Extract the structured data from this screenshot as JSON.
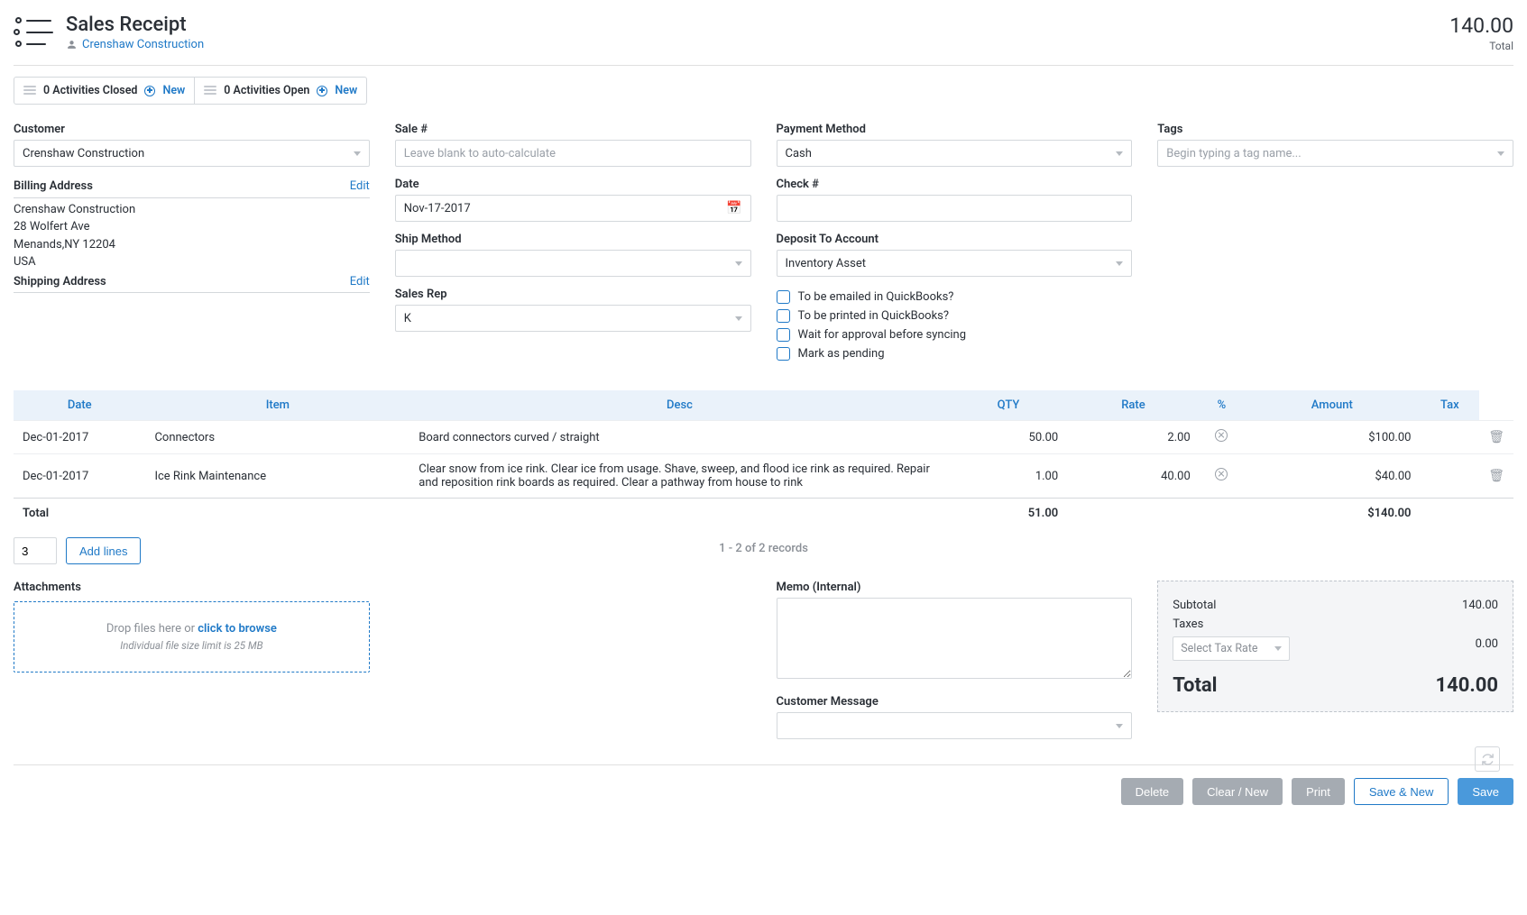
{
  "header": {
    "title": "Sales Receipt",
    "customer_link": "Crenshaw  Construction",
    "total_value": "140.00",
    "total_label": "Total"
  },
  "activities": {
    "closed_label": "0 Activities Closed",
    "open_label": "0 Activities Open",
    "new_label": "New"
  },
  "form": {
    "customer": {
      "label": "Customer",
      "value": "Crenshaw Construction"
    },
    "billing": {
      "label": "Billing Address",
      "edit": "Edit",
      "lines": [
        "Crenshaw Construction",
        "28 Wolfert Ave",
        "Menands,NY 12204",
        "USA"
      ]
    },
    "shipping": {
      "label": "Shipping Address",
      "edit": "Edit"
    },
    "sale_no": {
      "label": "Sale #",
      "placeholder": "Leave blank to auto-calculate"
    },
    "date": {
      "label": "Date",
      "value": "Nov-17-2017"
    },
    "ship_method": {
      "label": "Ship Method",
      "value": ""
    },
    "sales_rep": {
      "label": "Sales Rep",
      "value": "K"
    },
    "payment_method": {
      "label": "Payment Method",
      "value": "Cash"
    },
    "check_no": {
      "label": "Check #",
      "value": ""
    },
    "deposit_account": {
      "label": "Deposit To Account",
      "value": "Inventory Asset"
    },
    "checks": {
      "email": "To be emailed in QuickBooks?",
      "print": "To be printed in QuickBooks?",
      "approval": "Wait for approval before syncing",
      "pending": "Mark as pending"
    },
    "tags": {
      "label": "Tags",
      "placeholder": "Begin typing a tag name..."
    }
  },
  "columns": {
    "date": "Date",
    "item": "Item",
    "desc": "Desc",
    "qty": "QTY",
    "rate": "Rate",
    "pct": "%",
    "amount": "Amount",
    "tax": "Tax"
  },
  "rows": [
    {
      "date": "Dec-01-2017",
      "item": "Connectors",
      "desc": "Board connectors curved / straight",
      "qty": "50.00",
      "rate": "2.00",
      "amount": "$100.00"
    },
    {
      "date": "Dec-01-2017",
      "item": "Ice Rink Maintenance",
      "desc": "Clear snow from ice rink. Clear ice from usage. Shave, sweep, and flood ice rink as required. Repair and reposition rink boards as required. Clear a pathway from house to rink",
      "qty": "1.00",
      "rate": "40.00",
      "amount": "$40.00"
    }
  ],
  "table_total": {
    "label": "Total",
    "qty": "51.00",
    "amount": "$140.00"
  },
  "add_lines": {
    "count": "3",
    "button": "Add lines"
  },
  "records_info": "1 - 2 of 2 records",
  "attachments": {
    "label": "Attachments",
    "drop_prefix": "Drop files here or ",
    "drop_link": "click to browse",
    "hint": "Individual file size limit is 25 MB"
  },
  "memo": {
    "label": "Memo (Internal)"
  },
  "customer_message": {
    "label": "Customer Message"
  },
  "totals": {
    "subtotal_label": "Subtotal",
    "subtotal_value": "140.00",
    "taxes_label": "Taxes",
    "taxes_value": "0.00",
    "tax_rate_placeholder": "Select Tax Rate",
    "total_label": "Total",
    "total_value": "140.00"
  },
  "footer": {
    "delete": "Delete",
    "clear": "Clear / New",
    "print": "Print",
    "save_new": "Save & New",
    "save": "Save"
  }
}
